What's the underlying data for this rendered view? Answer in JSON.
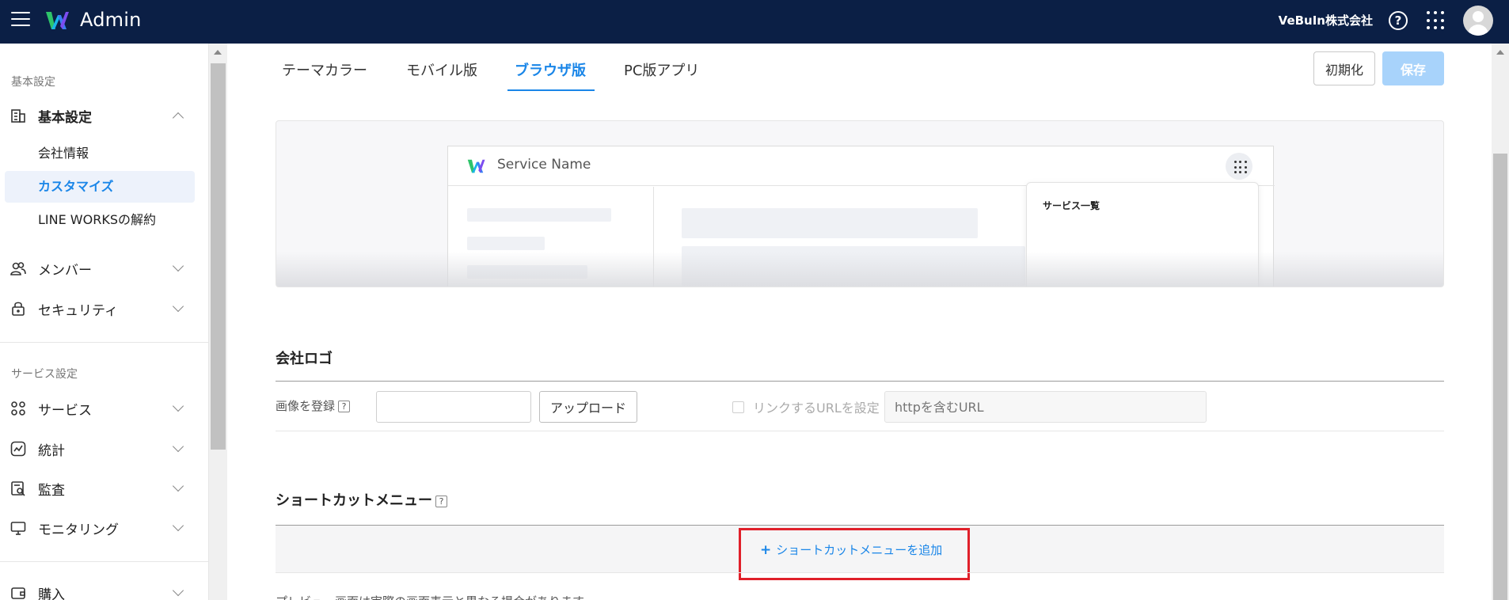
{
  "header": {
    "app_title": "Admin",
    "company_name": "VeBuIn株式会社",
    "help_icon": "?",
    "bg_color": "#0b1f45"
  },
  "sidebar": {
    "section_basic": "基本設定",
    "basic_settings": "基本設定",
    "sub_company_info": "会社情報",
    "sub_customize": "カスタマイズ",
    "sub_cancel": "LINE WORKSの解約",
    "members": "メンバー",
    "security": "セキュリティ",
    "section_service": "サービス設定",
    "services": "サービス",
    "statistics": "統計",
    "audit": "監査",
    "monitoring": "モニタリング",
    "purchase": "購入"
  },
  "tabs": {
    "theme_color": "テーマカラー",
    "mobile": "モバイル版",
    "browser": "ブラウザ版",
    "pc_app": "PC版アプリ",
    "active": "ブラウザ版"
  },
  "actions": {
    "reset": "初期化",
    "save": "保存"
  },
  "preview": {
    "service_name": "Service Name",
    "service_list": "サービス一覧"
  },
  "company_logo": {
    "title": "会社ロゴ",
    "register_image": "画像を登録",
    "upload": "アップロード",
    "link_url_label": "リンクするURLを設定",
    "url_placeholder": "httpを含むURL"
  },
  "shortcut_menu": {
    "title": "ショートカットメニュー",
    "add_label": "ショートカットメニューを追加"
  },
  "note": "プレビュー画面は実際の画面表示と異なる場合があります。",
  "colors": {
    "accent": "#1a86e8",
    "save_disabled": "#a8d3fb",
    "highlight": "#e0202a"
  }
}
